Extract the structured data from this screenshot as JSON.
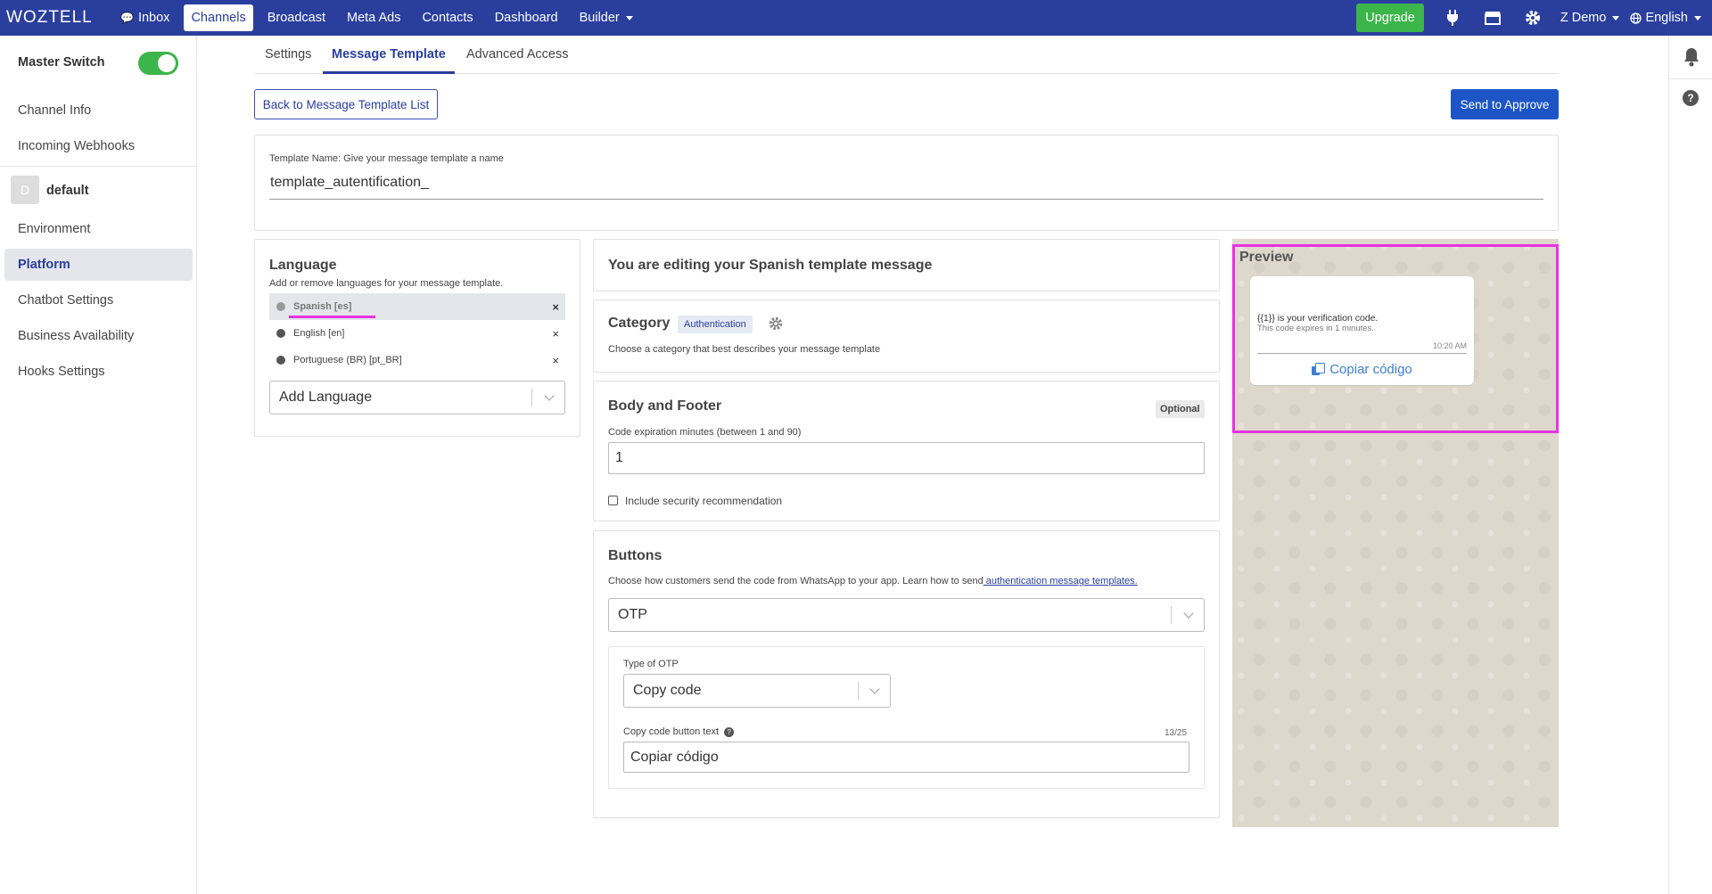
{
  "topnav": {
    "logo": "WOZTELL",
    "items": [
      {
        "label": "Inbox"
      },
      {
        "label": "Channels"
      },
      {
        "label": "Broadcast"
      },
      {
        "label": "Meta Ads"
      },
      {
        "label": "Contacts"
      },
      {
        "label": "Dashboard"
      },
      {
        "label": "Builder"
      }
    ],
    "upgrade": "Upgrade",
    "user": "Z Demo",
    "language": "English"
  },
  "sidebar": {
    "master_switch": "Master Switch",
    "links": [
      "Channel Info",
      "Incoming Webhooks"
    ],
    "env_avatar": "D",
    "env_name": "default",
    "items": [
      "Environment",
      "Platform",
      "Chatbot Settings",
      "Business Availability",
      "Hooks Settings"
    ]
  },
  "tabs": [
    "Settings",
    "Message Template",
    "Advanced Access"
  ],
  "actions": {
    "back": "Back to Message Template List",
    "approve": "Send to Approve"
  },
  "template": {
    "name_label": "Template Name: Give your message template a name",
    "name_value": "template_autentification_"
  },
  "language": {
    "title": "Language",
    "subtitle": "Add or remove languages for your message template.",
    "items": [
      {
        "label": "Spanish [es]"
      },
      {
        "label": "English [en]"
      },
      {
        "label": "Portuguese (BR) [pt_BR]"
      }
    ],
    "remove_symbol": "×",
    "add_placeholder": "Add Language"
  },
  "editing": {
    "title": "You are editing your Spanish template message"
  },
  "category": {
    "title": "Category",
    "badge": "Authentication",
    "desc": "Choose a category that best describes your message template"
  },
  "body": {
    "title": "Body and Footer",
    "optional": "Optional",
    "expiry_label": "Code expiration minutes (between 1 and 90)",
    "expiry_value": "1",
    "security_label": "Include security recommendation"
  },
  "buttons": {
    "title": "Buttons",
    "desc": "Choose how customers send the code from WhatsApp to your app. Learn how to send",
    "link": " authentication message templates.",
    "type_value": "OTP",
    "otp_type_label": "Type of OTP",
    "otp_type_value": "Copy code",
    "copy_label": "Copy code button text",
    "copy_counter": "13/25",
    "copy_value": "Copiar código"
  },
  "preview": {
    "title": "Preview",
    "line1": "{{1}} is your verification code.",
    "line2": "This code expires in 1 minutes.",
    "time": "10:20 AM",
    "button": "Copiar código"
  }
}
